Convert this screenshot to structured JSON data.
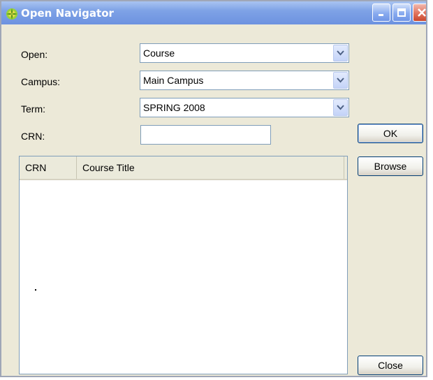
{
  "window": {
    "title": "Open Navigator",
    "title_bar_color": "#7ea2e6",
    "controls": [
      "minimize-icon",
      "maximize-icon",
      "close-icon"
    ]
  },
  "form": {
    "open_label": "Open:",
    "open_value": "Course",
    "campus_label": "Campus:",
    "campus_value": "Main Campus",
    "term_label": "Term:",
    "term_value": "SPRING 2008",
    "crn_label": "CRN:",
    "crn_value": ""
  },
  "buttons": {
    "ok_label": "OK",
    "browse_label": "Browse",
    "close_label": "Close"
  },
  "results": {
    "columns": [
      "CRN",
      "Course Title"
    ],
    "rows": []
  }
}
